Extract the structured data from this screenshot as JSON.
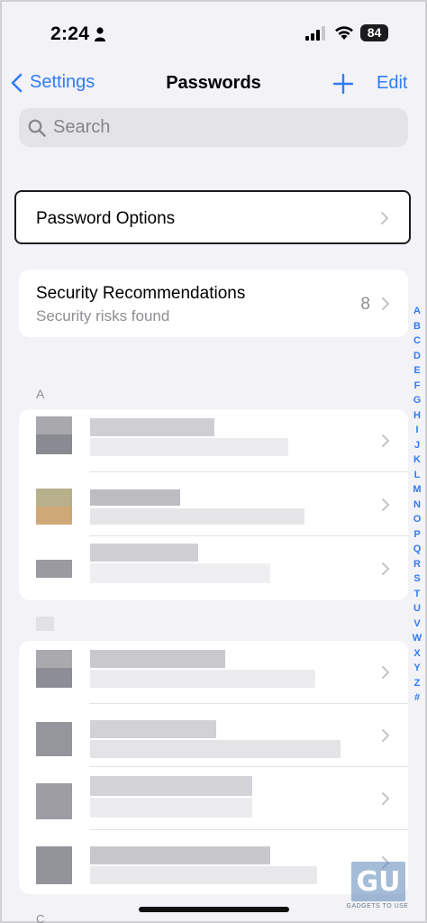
{
  "status_bar": {
    "time": "2:24",
    "battery": "84"
  },
  "nav": {
    "back_label": "Settings",
    "title": "Passwords",
    "edit_label": "Edit"
  },
  "search": {
    "placeholder": "Search"
  },
  "password_options": {
    "label": "Password Options"
  },
  "security": {
    "title": "Security Recommendations",
    "subtitle": "Security risks found",
    "count": "8"
  },
  "section_a": {
    "header": "A"
  },
  "section_c": {
    "header": "C"
  },
  "index_letters": [
    "A",
    "B",
    "C",
    "D",
    "E",
    "F",
    "G",
    "H",
    "I",
    "J",
    "K",
    "L",
    "M",
    "N",
    "O",
    "P",
    "Q",
    "R",
    "S",
    "T",
    "U",
    "V",
    "W",
    "X",
    "Y",
    "Z",
    "#"
  ],
  "watermark": {
    "logo": "GU",
    "text": "GADGETS TO USE"
  },
  "colors": {
    "accent": "#2f7cf6",
    "background": "#f2f2f7",
    "secondary_text": "#8e8e93"
  }
}
